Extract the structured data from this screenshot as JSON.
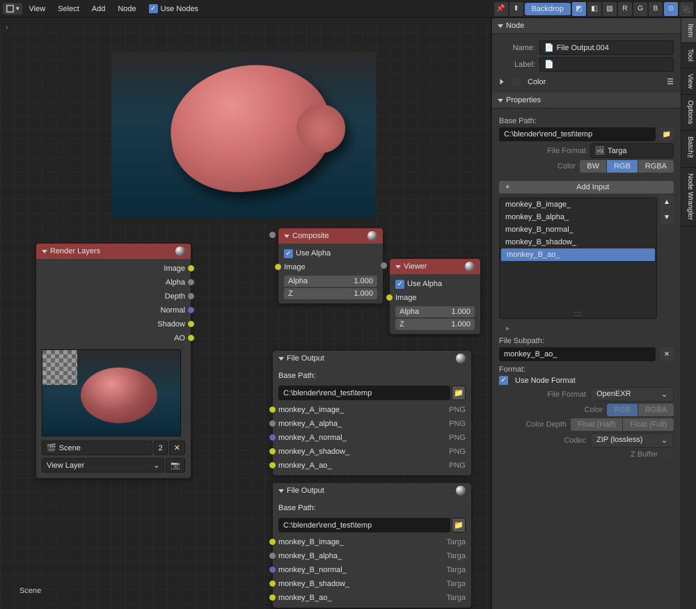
{
  "header": {
    "menus": [
      "View",
      "Select",
      "Add",
      "Node"
    ],
    "useNodesLabel": "Use Nodes",
    "backdropLabel": "Backdrop",
    "channels": [
      "R",
      "G",
      "B"
    ]
  },
  "sideTabs": [
    "Item",
    "Tool",
    "View",
    "Options",
    "Batch™",
    "Node Wrangler"
  ],
  "nodes": {
    "renderLayers": {
      "title": "Render Layers",
      "outputs": [
        "Image",
        "Alpha",
        "Depth",
        "Normal",
        "Shadow",
        "AO"
      ],
      "scene": "Scene",
      "sceneUsers": "2",
      "viewLayer": "View Layer"
    },
    "composite": {
      "title": "Composite",
      "useAlpha": "Use Alpha",
      "inputs": [
        {
          "name": "Image",
          "type": "yellow"
        },
        {
          "name": "Alpha",
          "value": "1.000",
          "type": "grey"
        },
        {
          "name": "Z",
          "value": "1.000",
          "type": "grey"
        }
      ]
    },
    "viewer": {
      "title": "Viewer",
      "useAlpha": "Use Alpha",
      "inputs": [
        {
          "name": "Image",
          "type": "yellow"
        },
        {
          "name": "Alpha",
          "value": "1.000",
          "type": "grey"
        },
        {
          "name": "Z",
          "value": "1.000",
          "type": "grey"
        }
      ]
    },
    "fileOutputA": {
      "title": "File Output",
      "basePathLabel": "Base Path:",
      "basePath": "C:\\blender\\rend_test\\temp",
      "slots": [
        {
          "name": "monkey_A_image_",
          "fmt": "PNG",
          "type": "yellow"
        },
        {
          "name": "monkey_A_alpha_",
          "fmt": "PNG",
          "type": "grey"
        },
        {
          "name": "monkey_A_normal_",
          "fmt": "PNG",
          "type": "purple"
        },
        {
          "name": "monkey_A_shadow_",
          "fmt": "PNG",
          "type": "yellow"
        },
        {
          "name": "monkey_A_ao_",
          "fmt": "PNG",
          "type": "yellow"
        }
      ]
    },
    "fileOutputB": {
      "title": "File Output",
      "basePathLabel": "Base Path:",
      "basePath": "C:\\blender\\rend_test\\temp",
      "slots": [
        {
          "name": "monkey_B_image_",
          "fmt": "Targa",
          "type": "yellow"
        },
        {
          "name": "monkey_B_alpha_",
          "fmt": "Targa",
          "type": "grey"
        },
        {
          "name": "monkey_B_normal_",
          "fmt": "Targa",
          "type": "purple"
        },
        {
          "name": "monkey_B_shadow_",
          "fmt": "Targa",
          "type": "yellow"
        },
        {
          "name": "monkey_B_ao_",
          "fmt": "Targa",
          "type": "yellow"
        }
      ]
    }
  },
  "sidebar": {
    "nodeSection": "Node",
    "nameLabel": "Name:",
    "nameValue": "File Output.004",
    "labelLabel": "Label:",
    "colorLabel": "Color",
    "propertiesSection": "Properties",
    "basePathLabel": "Base Path:",
    "basePath": "C:\\blender\\rend_test\\temp",
    "fileFormatLabel": "File Format",
    "fileFormat": "Targa",
    "colorModeLabel": "Color",
    "colorModes": [
      "BW",
      "RGB",
      "RGBA"
    ],
    "addInput": "Add Input",
    "inputsList": [
      "monkey_B_image_",
      "monkey_B_alpha_",
      "monkey_B_normal_",
      "monkey_B_shadow_",
      "monkey_B_ao_"
    ],
    "fileSubpathLabel": "File Subpath:",
    "fileSubpath": "monkey_B_ao_",
    "formatLabel": "Format:",
    "useNodeFormat": "Use Node Format",
    "fmt2Label": "File Format",
    "fmt2Value": "OpenEXR",
    "color2Label": "Color",
    "color2Opts": [
      "RGB",
      "RGBA"
    ],
    "depthLabel": "Color Depth",
    "depthOpts": [
      "Float (Half)",
      "Float (Full)"
    ],
    "codecLabel": "Codec",
    "codecValue": "ZIP (lossless)",
    "zbufferLabel": "Z Buffer"
  },
  "scene": "Scene"
}
